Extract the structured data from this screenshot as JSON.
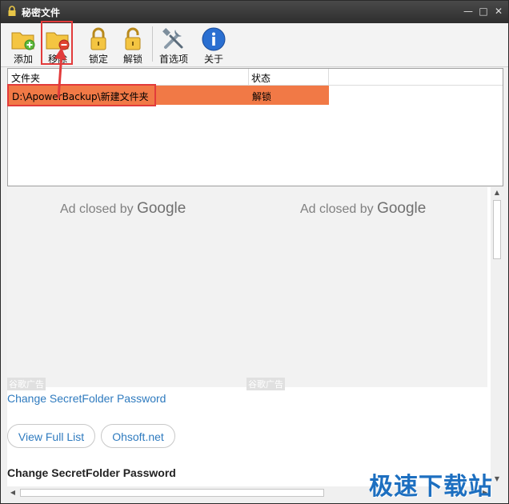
{
  "window": {
    "title": "秘密文件"
  },
  "toolbar": {
    "add_label": "添加",
    "remove_label": "移除",
    "lock_label": "锁定",
    "unlock_label": "解锁",
    "preferences_label": "首选项",
    "about_label": "关于"
  },
  "folder_list": {
    "headers": {
      "folder": "文件夹",
      "status": "状态"
    },
    "rows": [
      {
        "folder": "D:\\ApowerBackup\\新建文件夹",
        "status": "解锁"
      }
    ]
  },
  "ads": {
    "left": {
      "prefix": "Ad closed by",
      "brand": "Google",
      "label": "谷歌广告"
    },
    "right": {
      "prefix": "Ad closed by",
      "brand": "Google",
      "label": "谷歌广告"
    }
  },
  "content": {
    "link": "Change SecretFolder Password",
    "view_full_list": "View Full List",
    "ohsoft": "Ohsoft.net",
    "heading": "Change SecretFolder Password"
  },
  "watermark": "极速下载站",
  "colors": {
    "selected_row": "#f17946",
    "highlight_box": "#e23b3b",
    "link": "#2f7bbf"
  }
}
